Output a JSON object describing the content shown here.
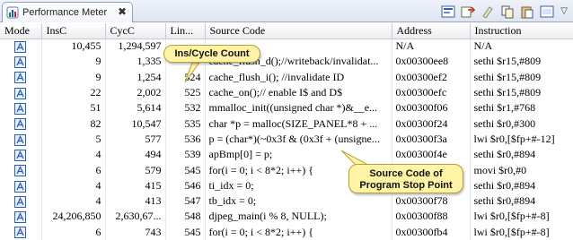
{
  "tab": {
    "title": "Performance Meter",
    "close_symbol": "✖"
  },
  "toolbar": {
    "icons": [
      "profile-icon",
      "export-icon",
      "clear-icon",
      "copy-icon",
      "paste-icon",
      "settings-icon"
    ],
    "menu_symbol": "▽"
  },
  "columns": [
    "Mode",
    "InsC",
    "CycC",
    "Lin...",
    "Source Code",
    "Address",
    "Instruction"
  ],
  "rows": [
    {
      "insc": "10,455",
      "cycc": "1,294,597",
      "line": "",
      "source": "",
      "address": "N/A",
      "instruction": "N/A"
    },
    {
      "insc": "9",
      "cycc": "1,335",
      "line": "",
      "source": "cache_flush_d();//writeback/invalidat...",
      "address": "0x00300ee8",
      "instruction": "sethi $r15,#809"
    },
    {
      "insc": "9",
      "cycc": "1,254",
      "line": "524",
      "source": "cache_flush_i(); //invalidate ID",
      "address": "0x00300ef2",
      "instruction": "sethi $r15,#809"
    },
    {
      "insc": "22",
      "cycc": "2,002",
      "line": "525",
      "source": "cache_on();// enable I$ and D$",
      "address": "0x00300efc",
      "instruction": "sethi $r15,#809"
    },
    {
      "insc": "51",
      "cycc": "5,614",
      "line": "532",
      "source": "mmalloc_init((unsigned char *)&__e...",
      "address": "0x00300f06",
      "instruction": "sethi $r1,#768"
    },
    {
      "insc": "82",
      "cycc": "10,547",
      "line": "535",
      "source": "char *p = malloc(SIZE_PANEL*8 + ...",
      "address": "0x00300f24",
      "instruction": "sethi $r0,#300"
    },
    {
      "insc": "5",
      "cycc": "577",
      "line": "536",
      "source": "p = (char*)(~0x3f & (0x3f + (unsigne...",
      "address": "0x00300f3a",
      "instruction": "lwi $r0,[$fp+#-12]"
    },
    {
      "insc": "4",
      "cycc": "494",
      "line": "539",
      "source": "apBmp[0] = p;",
      "address": "0x00300f4e",
      "instruction": "sethi $r0,#894"
    },
    {
      "insc": "6",
      "cycc": "579",
      "line": "545",
      "source": "for(i = 0; i < 8*2; i++) {",
      "address": "",
      "instruction": "movi $r0,#0"
    },
    {
      "insc": "4",
      "cycc": "415",
      "line": "546",
      "source": "ti_idx = 0;",
      "address": "0x00300f6a",
      "instruction": "sethi $r0,#894"
    },
    {
      "insc": "4",
      "cycc": "413",
      "line": "547",
      "source": "tb_idx = 0;",
      "address": "0x00300f78",
      "instruction": "sethi $r0,#894"
    },
    {
      "insc": "24,206,850",
      "cycc": "2,630,67...",
      "line": "548",
      "source": "djpeg_main(i % 8, NULL);",
      "address": "0x00300f88",
      "instruction": "lwi $r0,[$fp+#-8]"
    },
    {
      "insc": "6",
      "cycc": "743",
      "line": "545",
      "source": "for(i = 0; i < 8*2; i++) {",
      "address": "0x00300fb4",
      "instruction": "lwi $r0,[$fp+#-8]"
    }
  ],
  "callouts": {
    "ins_cycle": "Ins/Cycle Count",
    "source_line1": "Source Code of",
    "source_line2": "Program Stop Point"
  },
  "colors": {
    "callout_fill": "#fff3a6",
    "tab_bar": "#dfe6f1",
    "mode_icon": "#2a5fb0"
  }
}
